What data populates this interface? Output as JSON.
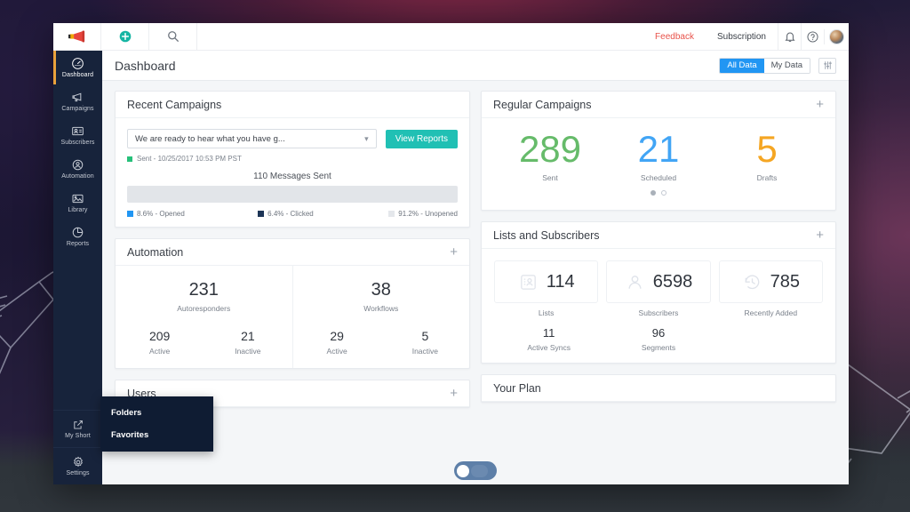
{
  "appbar": {
    "logo_icon": "megaphone-icon",
    "add_icon": "plus-circle-icon",
    "search_icon": "search-icon",
    "feedback_label": "Feedback",
    "subscription_label": "Subscription",
    "bell_icon": "bell-icon",
    "help_icon": "question-circle-icon",
    "avatar_icon": "user-avatar"
  },
  "sidebar": {
    "items": [
      {
        "label": "Dashboard",
        "icon": "gauge-icon",
        "active": true
      },
      {
        "label": "Campaigns",
        "icon": "megaphone-icon",
        "active": false
      },
      {
        "label": "Subscribers",
        "icon": "contact-card-icon",
        "active": false
      },
      {
        "label": "Automation",
        "icon": "gear-person-icon",
        "active": false
      },
      {
        "label": "Library",
        "icon": "image-icon",
        "active": false
      },
      {
        "label": "Reports",
        "icon": "pie-chart-icon",
        "active": false
      }
    ],
    "bottom_items": [
      {
        "label": "My Short",
        "icon": "external-link-icon"
      },
      {
        "label": "Settings",
        "icon": "gear-icon"
      }
    ]
  },
  "page": {
    "title": "Dashboard",
    "segments": [
      {
        "label": "All Data",
        "selected": true
      },
      {
        "label": "My Data",
        "selected": false
      }
    ],
    "filter_icon": "sliders-icon"
  },
  "recent_campaigns": {
    "title": "Recent Campaigns",
    "select_value": "We are ready to hear what you have g...",
    "select_caret_icon": "chevron-down-icon",
    "view_reports_label": "View Reports",
    "status_text": "Sent - 10/25/2017 10:53 PM PST",
    "status_color": "#27c07a",
    "messages_sent": "110 Messages Sent",
    "legend": [
      {
        "label": "8.6% - Opened",
        "color": "#2196f3"
      },
      {
        "label": "6.4% - Clicked",
        "color": "#1d3557"
      },
      {
        "label": "91.2% - Unopened",
        "color": "#e4e7eb"
      }
    ]
  },
  "regular_campaigns": {
    "title": "Regular Campaigns",
    "add_icon": "plus-icon",
    "stats": [
      {
        "value": "289",
        "label": "Sent",
        "color": "#66bb6a"
      },
      {
        "value": "21",
        "label": "Scheduled",
        "color": "#42a5f5"
      },
      {
        "value": "5",
        "label": "Drafts",
        "color": "#f5a623"
      }
    ],
    "carousel": {
      "active_index": 0,
      "count": 2
    }
  },
  "automation": {
    "title": "Automation",
    "add_icon": "plus-icon",
    "groups": [
      {
        "value": "231",
        "label": "Autoresponders",
        "sub": [
          {
            "value": "209",
            "label": "Active"
          },
          {
            "value": "21",
            "label": "Inactive"
          }
        ]
      },
      {
        "value": "38",
        "label": "Workflows",
        "sub": [
          {
            "value": "29",
            "label": "Active"
          },
          {
            "value": "5",
            "label": "Inactive"
          }
        ]
      }
    ]
  },
  "lists_subscribers": {
    "title": "Lists and Subscribers",
    "add_icon": "plus-icon",
    "tiles": [
      {
        "value": "114",
        "label": "Lists",
        "icon": "contact-card-icon"
      },
      {
        "value": "6598",
        "label": "Subscribers",
        "icon": "user-icon"
      },
      {
        "value": "785",
        "label": "Recently Added",
        "icon": "history-icon"
      }
    ],
    "sub": [
      {
        "value": "11",
        "label": "Active Syncs"
      },
      {
        "value": "96",
        "label": "Segments"
      }
    ]
  },
  "users_card": {
    "title": "Users",
    "add_icon": "plus-icon"
  },
  "your_plan_card": {
    "title": "Your Plan"
  },
  "context_menu": {
    "items": [
      {
        "label": "Folders"
      },
      {
        "label": "Favorites"
      }
    ]
  },
  "floating_toggle": {
    "state": "on"
  },
  "decorations": {
    "left_icon": "megaphone-outline",
    "right_icon": "megaphone-outline"
  }
}
